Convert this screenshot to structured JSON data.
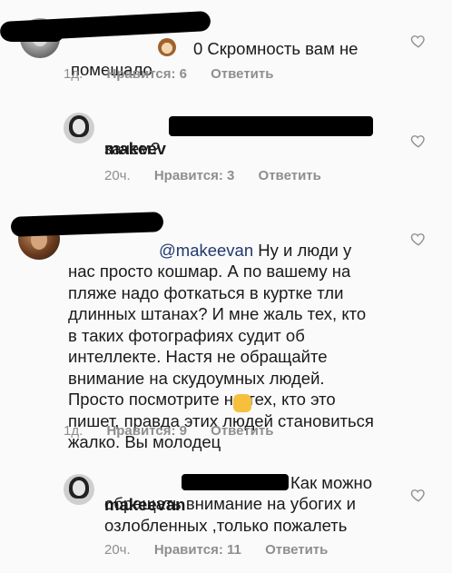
{
  "comments": [
    {
      "text_start": "0 Скромность вам  не\nпомешало",
      "time": "1д.",
      "likes": "Нравится: 6",
      "reply": "Ответить"
    },
    {
      "username": "makeev",
      "text": "зачем?",
      "time": "20ч.",
      "likes": "Нравится: 3",
      "reply": "Ответить"
    },
    {
      "mention": "@makeevan",
      "text": " Ну и люди у\nнас просто кошмар. А по вашему на\nпляже надо фоткаться в куртке тли\nдлинных штанах? И мне жаль тех, кто\nв таких фотографиях судит об\nинтеллекте. Настя не обращайте\nвнимание на скудоумных людей.\nПросто посмотрите на тех, кто это\nпишет, правда этих людей становиться\nжалко. Вы молодец",
      "time": "1д.",
      "likes": "Нравится: 9",
      "reply": "Ответить"
    },
    {
      "username": "makeevan",
      "text_first": "Как можно",
      "text": "обращать внимание на убогих и\nозлобленных ,только пожалеть",
      "time": "20ч.",
      "likes": "Нравится: 11",
      "reply": "Ответить"
    }
  ],
  "icons": {
    "like": "heart-outline-icon",
    "monkey": "see-no-evil-monkey-emoji",
    "fist": "raised-fist-emoji"
  }
}
